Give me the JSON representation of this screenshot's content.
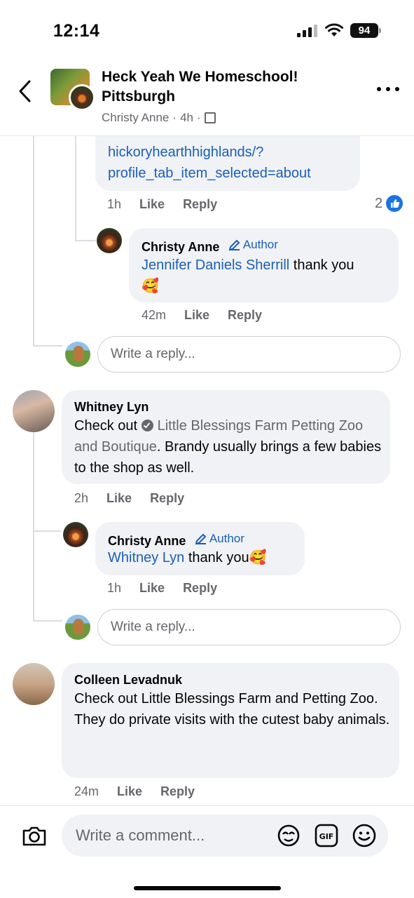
{
  "status_bar": {
    "time": "12:14",
    "battery": "94"
  },
  "header": {
    "title": "Heck Yeah We Homeschool! Pittsburgh",
    "author": "Christy Anne",
    "time_ago": "4h",
    "separator": "·"
  },
  "link_comment": {
    "url_partial": "hickoryhearthhighlands/?",
    "url_line2": "profile_tab_item_selected=about",
    "time": "1h",
    "like": "Like",
    "reply": "Reply",
    "reaction_count": "2"
  },
  "reply_christy_1": {
    "name": "Christy Anne",
    "badge": "Author",
    "mention": "Jennifer Daniels Sherrill",
    "text": " thank you",
    "emoji": "🥰",
    "time": "42m",
    "like": "Like",
    "reply": "Reply"
  },
  "reply_input_1": {
    "placeholder": "Write a reply..."
  },
  "comment_whitney": {
    "name": "Whitney Lyn",
    "prefix": "Check out ",
    "page_name": "Little Blessings Farm Petting Zoo and Boutique",
    "suffix": ". Brandy usually brings a few babies to the shop as well.",
    "time": "2h",
    "like": "Like",
    "reply": "Reply"
  },
  "reply_christy_2": {
    "name": "Christy Anne",
    "badge": "Author",
    "mention": "Whitney Lyn",
    "text": " thank you",
    "emoji": "🥰",
    "time": "1h",
    "like": "Like",
    "reply": "Reply"
  },
  "reply_input_2": {
    "placeholder": "Write a reply..."
  },
  "comment_colleen": {
    "name": "Colleen Levadnuk",
    "line1": "Check out Little Blessings Farm and Petting Zoo.",
    "line2": "They do private visits with the cutest baby animals.",
    "time": "24m",
    "like": "Like",
    "reply": "Reply"
  },
  "composer": {
    "placeholder": "Write a comment..."
  },
  "colors": {
    "link": "#1b5fb8",
    "like_blue": "#1b74e4",
    "bubble": "#f0f2f5",
    "meta": "#65676b"
  },
  "icons": [
    "back-chevron-icon",
    "more-dots-icon",
    "public-group-icon",
    "like-reaction-icon",
    "author-pencil-icon",
    "verified-page-icon",
    "camera-icon",
    "avatar-sticker-icon",
    "gif-icon",
    "emoji-icon"
  ]
}
